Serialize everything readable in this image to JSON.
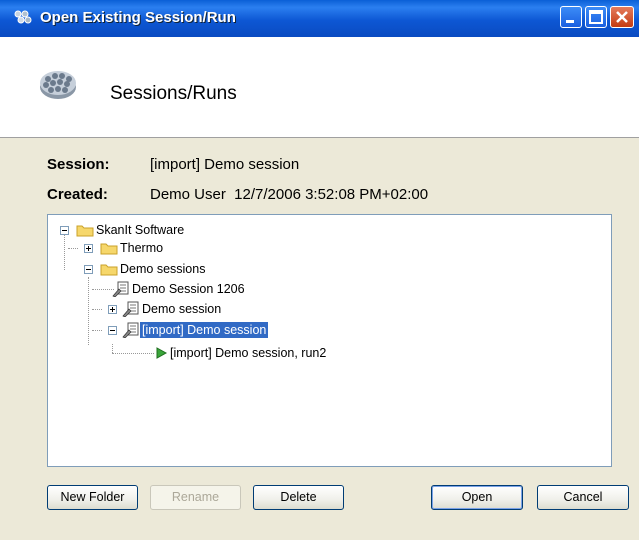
{
  "window": {
    "title": "Open Existing Session/Run"
  },
  "header": {
    "title": "Sessions/Runs"
  },
  "info": {
    "session_label": "Session:",
    "session_value": "[import] Demo session",
    "created_label": "Created:",
    "created_value": "Demo User  12/7/2006 3:52:08 PM+02:00"
  },
  "tree": {
    "root": "SkanIt Software",
    "thermo": "Thermo",
    "demo_sessions": "Demo sessions",
    "session_1206": "Demo Session 1206",
    "demo_session": "Demo session",
    "import_session": "[import] Demo session",
    "import_run": "[import] Demo session, run2"
  },
  "buttons": {
    "new_folder": "New Folder",
    "rename": "Rename",
    "delete": "Delete",
    "open": "Open",
    "cancel": "Cancel"
  },
  "colors": {
    "title_bar": "#0a5fd6",
    "selection": "#316ac5",
    "dialog_bg": "#ece9d8"
  }
}
